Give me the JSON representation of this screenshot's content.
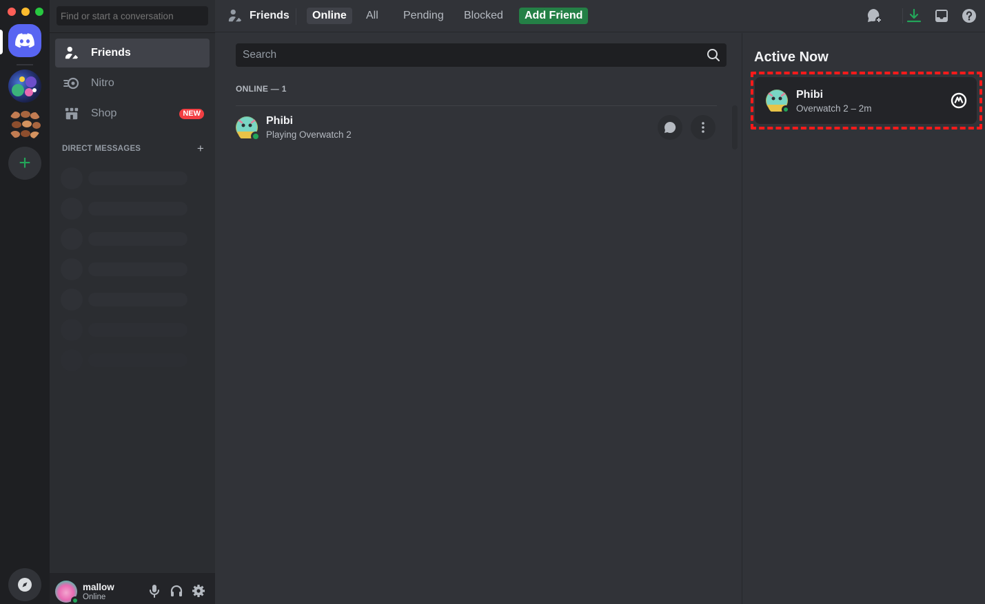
{
  "search_conversation": {
    "placeholder": "Find or start a conversation"
  },
  "sidebar": {
    "items": [
      {
        "label": "Friends",
        "icon": "friends-icon"
      },
      {
        "label": "Nitro",
        "icon": "nitro-icon"
      },
      {
        "label": "Shop",
        "icon": "shop-icon",
        "badge": "NEW"
      }
    ],
    "dm_header": "DIRECT MESSAGES",
    "dm_add": "+"
  },
  "user": {
    "name": "mallow",
    "status": "Online"
  },
  "topbar": {
    "title": "Friends",
    "tabs": [
      "Online",
      "All",
      "Pending",
      "Blocked"
    ],
    "add_friend": "Add Friend"
  },
  "friends": {
    "search_placeholder": "Search",
    "online_header": "ONLINE — 1",
    "list": [
      {
        "name": "Phibi",
        "activity": "Playing Overwatch 2",
        "status": "online"
      }
    ]
  },
  "active_now": {
    "title": "Active Now",
    "cards": [
      {
        "name": "Phibi",
        "game": "Overwatch 2 – 2m",
        "game_icon": "overwatch-icon"
      }
    ]
  },
  "colors": {
    "blurple": "#5865f2",
    "green": "#23a559",
    "add_friend_bg": "#248046",
    "new_badge": "#f23f43",
    "highlight": "#ff1a1a"
  }
}
